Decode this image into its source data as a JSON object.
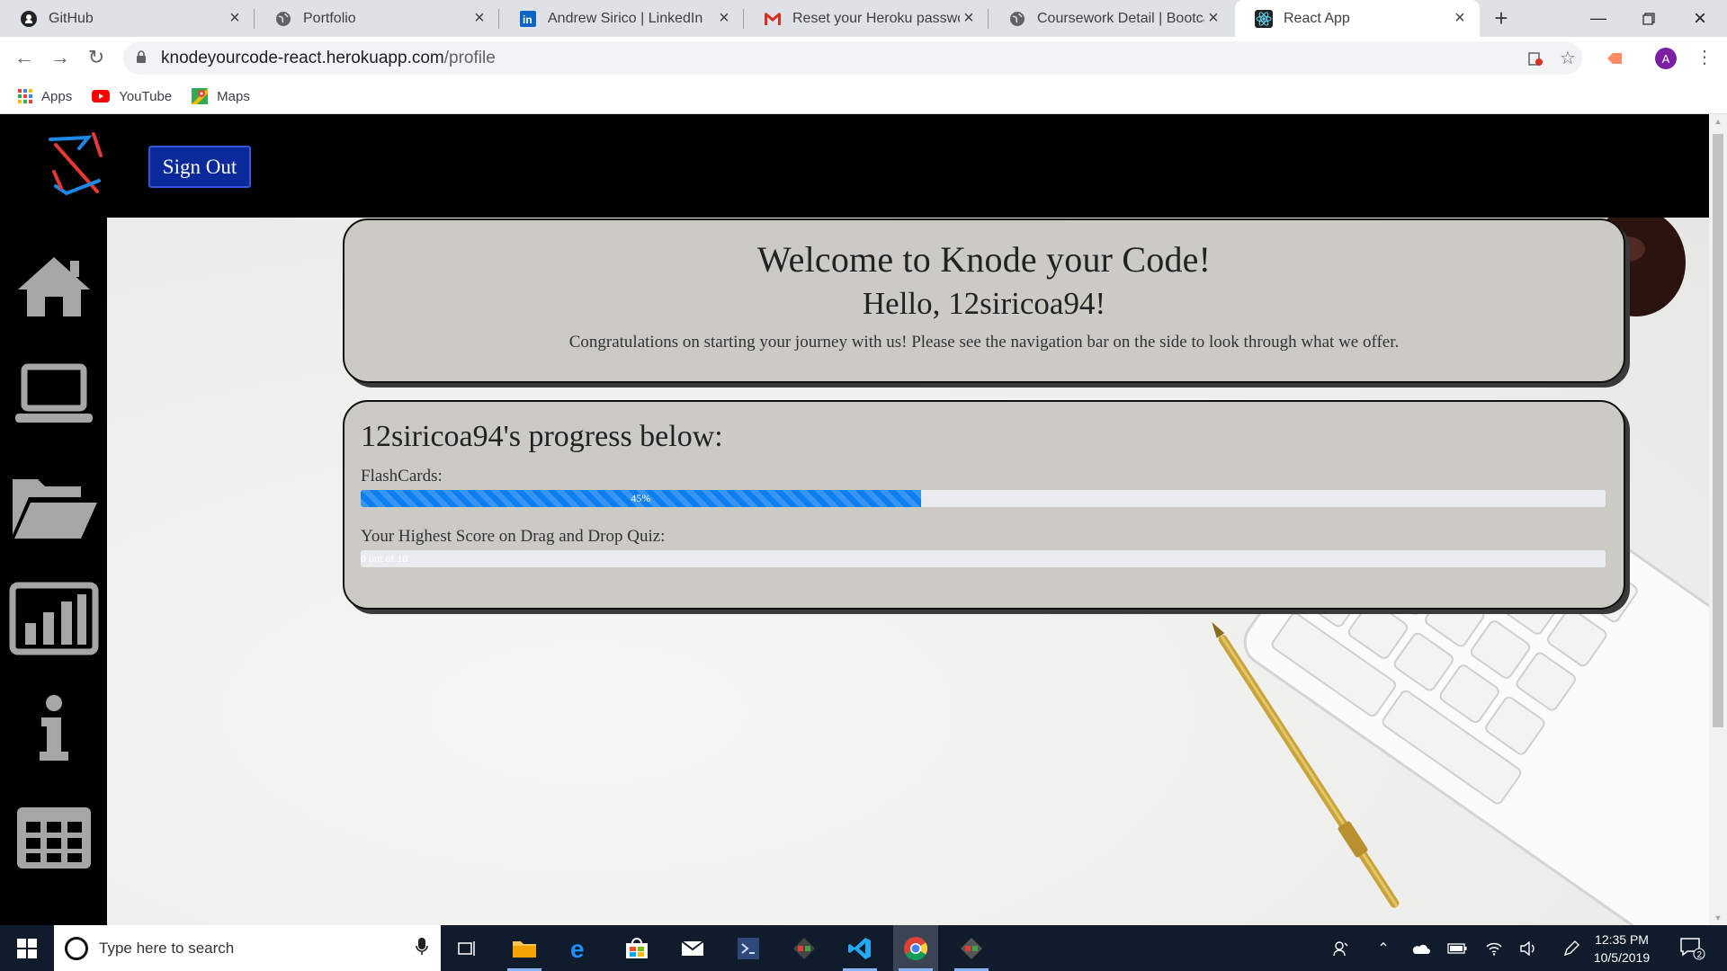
{
  "browser": {
    "tabs": [
      {
        "title": "GitHub",
        "icon": "github-icon"
      },
      {
        "title": "Portfolio",
        "icon": "globe-icon"
      },
      {
        "title": "Andrew Sirico | LinkedIn",
        "icon": "linkedin-icon"
      },
      {
        "title": "Reset your Heroku password",
        "icon": "gmail-icon"
      },
      {
        "title": "Coursework Detail | Bootcam",
        "icon": "globe-icon"
      },
      {
        "title": "React App",
        "icon": "react-icon"
      }
    ],
    "active_tab": "React App",
    "url_host": "knodeyourcode-react.herokuapp.com",
    "url_path": "/profile",
    "profile_initial": "A",
    "bookmarks": [
      {
        "label": "Apps",
        "icon": "apps-grid-icon"
      },
      {
        "label": "YouTube",
        "icon": "youtube-icon"
      },
      {
        "label": "Maps",
        "icon": "maps-icon"
      }
    ]
  },
  "app": {
    "signout_label": "Sign Out",
    "side_nav": [
      {
        "name": "home-icon"
      },
      {
        "name": "laptop-icon"
      },
      {
        "name": "folder-open-icon"
      },
      {
        "name": "bar-chart-icon"
      },
      {
        "name": "info-icon"
      },
      {
        "name": "table-grid-icon"
      }
    ],
    "welcome": {
      "title": "Welcome to Knode your Code!",
      "greeting": "Hello, 12siricoa94!",
      "message": "Congratulations on starting your journey with us! Please see the navigation bar on the side to look through what we offer."
    },
    "progress": {
      "heading": "12siricoa94's progress below:",
      "flashcards_label": "FlashCards:",
      "flashcards_percent": 45,
      "flashcards_text": "45%",
      "quiz_label": "Your Highest Score on Drag and Drop Quiz:",
      "quiz_score": 0,
      "quiz_max": 10,
      "quiz_text": "0 out of 10"
    }
  },
  "taskbar": {
    "search_placeholder": "Type here to search",
    "time": "12:35 PM",
    "date": "10/5/2019",
    "notification_count": "2"
  },
  "colors": {
    "nav_bg": "#000000",
    "signout_bg": "#0a2a9c",
    "card_bg": "#cbcac5",
    "progress_fill": "#0d7ef0",
    "taskbar_bg": "#101b2b"
  }
}
